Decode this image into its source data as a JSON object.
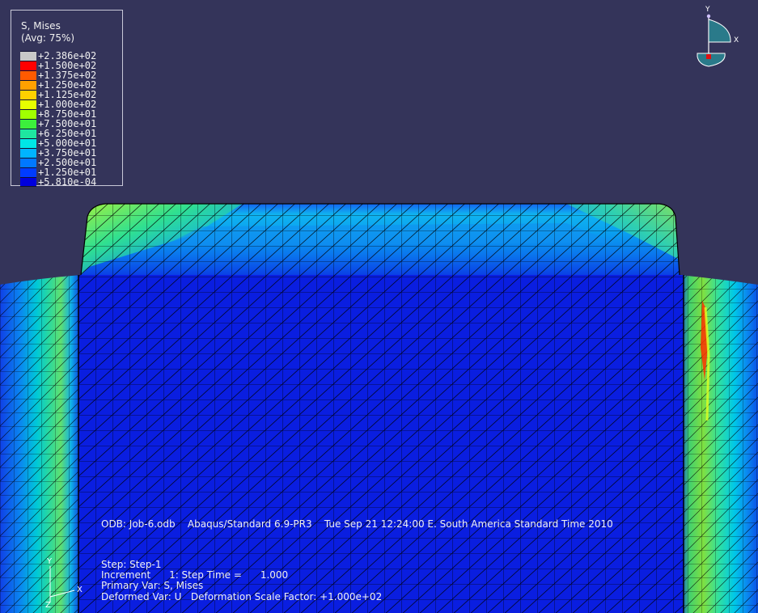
{
  "legend": {
    "title_line1": "S, Mises",
    "title_line2": "(Avg: 75%)",
    "entries": [
      {
        "value": "+2.386e+02",
        "color": "#c8c8c8"
      },
      {
        "value": "+1.500e+02",
        "color": "#ff0000"
      },
      {
        "value": "+1.375e+02",
        "color": "#ff5a00"
      },
      {
        "value": "+1.250e+02",
        "color": "#ffa000"
      },
      {
        "value": "+1.125e+02",
        "color": "#ffd000"
      },
      {
        "value": "+1.000e+02",
        "color": "#e6ff00"
      },
      {
        "value": "+8.750e+01",
        "color": "#a0ff00"
      },
      {
        "value": "+7.500e+01",
        "color": "#3cf03c"
      },
      {
        "value": "+6.250e+01",
        "color": "#1ee6a0"
      },
      {
        "value": "+5.000e+01",
        "color": "#00e6e6"
      },
      {
        "value": "+3.750e+01",
        "color": "#00b4ff"
      },
      {
        "value": "+2.500e+01",
        "color": "#0078ff"
      },
      {
        "value": "+1.250e+01",
        "color": "#003cff"
      },
      {
        "value": "+5.810e-04",
        "color": "#0000dc"
      }
    ]
  },
  "info": {
    "odb_line": "ODB: Job-6.odb    Abaqus/Standard 6.9-PR3    Tue Sep 21 12:24:00 E. South America Standard Time 2010",
    "step_line": "Step: Step-1",
    "increment_line": "Increment      1: Step Time =      1.000",
    "primary_var_line": "Primary Var: S, Mises",
    "deformed_var_line": "Deformed Var: U   Deformation Scale Factor: +1.000e+02"
  },
  "triad_bottom": {
    "y": "Y",
    "x": "X",
    "z": "Z"
  },
  "triad_top": {
    "y": "Y",
    "x": "X"
  },
  "colors": {
    "background": "#34345a",
    "mesh_line": "#000000",
    "low_stress": "#0a1ee0",
    "peak_stress": "#ff3000"
  }
}
